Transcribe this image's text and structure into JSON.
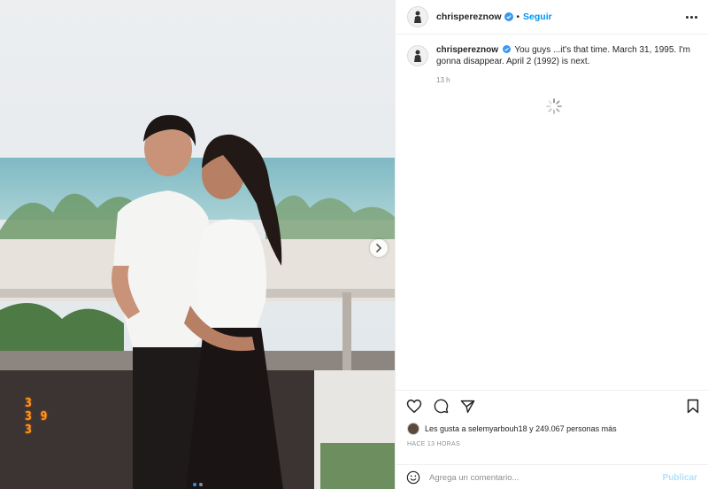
{
  "header": {
    "username": "chrisperez now",
    "follow_label": "Seguir",
    "separator": "•"
  },
  "caption": {
    "username": "chrispereznow",
    "text": "You guys ...it's that time. March 31, 1995. I'm gonna disappear. April 2 (1992) is next.",
    "time": "13 h"
  },
  "photo": {
    "date_stamp": "3\n3 9\n3",
    "carousel_total": 2,
    "carousel_active": 1
  },
  "likes": {
    "text": "Les gusta a selemyarbouh18 y 249.067 personas más"
  },
  "posted": "HACE 13 HORAS",
  "comment": {
    "placeholder": "Agrega un comentario...",
    "publish_label": "Publicar"
  },
  "colors": {
    "accent": "#0095f6",
    "verified": "#3897f0",
    "date_stamp": "#ff9a1f"
  }
}
